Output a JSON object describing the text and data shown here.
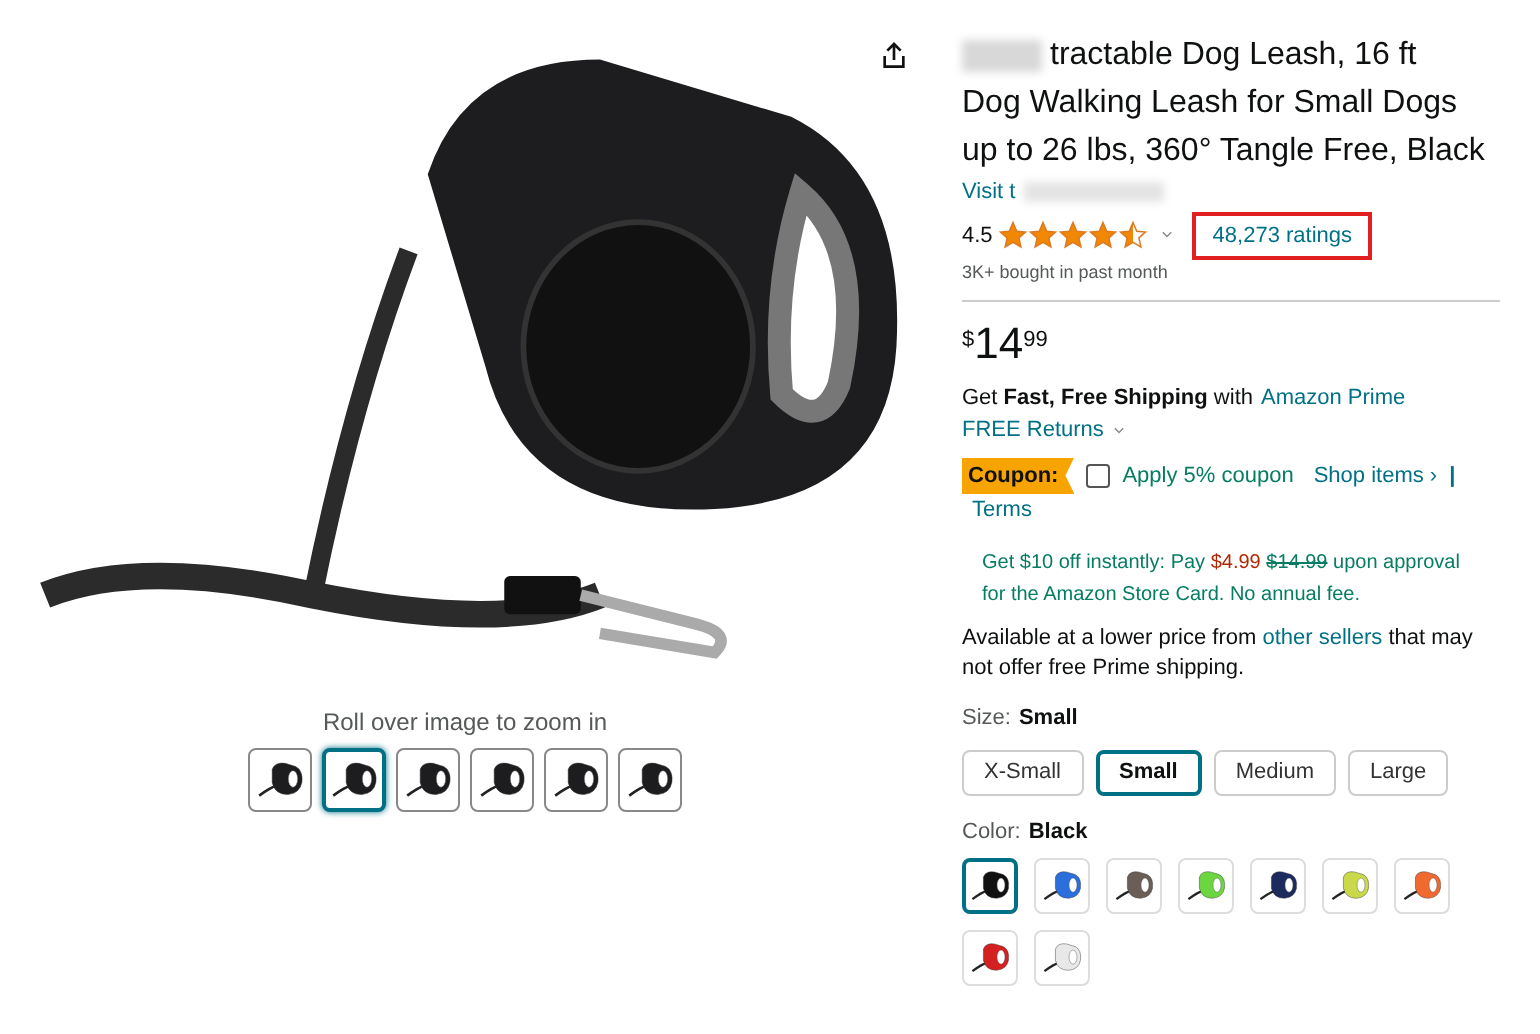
{
  "gallery": {
    "hint": "Roll over image to zoom in",
    "thumbnails": [
      {
        "selected": false
      },
      {
        "selected": true
      },
      {
        "selected": false
      },
      {
        "selected": false
      },
      {
        "selected": false
      },
      {
        "selected": false
      }
    ]
  },
  "product": {
    "title_first_line": "tractable Dog Leash, 16 ft",
    "title_rest": "Dog Walking Leash for Small Dogs up to 26 lbs, 360° Tangle Free, Black",
    "store_link": "Visit t",
    "rating": "4.5",
    "stars": 4.5,
    "ratings_count": "48,273 ratings",
    "bought": "3K+ bought in past month",
    "price": {
      "currency": "$",
      "whole": "14",
      "fraction": "99"
    },
    "shipping": "Get **Fast, Free Shipping** with",
    "prime": "Amazon Prime",
    "returns": "FREE Returns",
    "coupon": {
      "badge": "Coupon:",
      "checked": false,
      "label": "Apply 5% coupon",
      "shop": "Shop items ›",
      "sep": "|",
      "terms": "Terms"
    },
    "card_offer": {
      "text1": "Get $10 off instantly: Pay",
      "new_price": "$4.99",
      "old_price": "$14.99",
      "text2": "upon approval for the Amazon Store Card. No annual fee."
    },
    "lower_price": {
      "before": "Available at a lower price from",
      "link": "other sellers",
      "after": "that may not offer free Prime shipping."
    },
    "size": {
      "label": "Size:",
      "value": "Small",
      "options": [
        {
          "label": "X-Small",
          "selected": false
        },
        {
          "label": "Small",
          "selected": true
        },
        {
          "label": "Medium",
          "selected": false
        },
        {
          "label": "Large",
          "selected": false
        }
      ]
    },
    "color": {
      "label": "Color:",
      "value": "Black",
      "options": [
        {
          "color": "#111111",
          "selected": true
        },
        {
          "color": "#2a6fdb",
          "selected": false
        },
        {
          "color": "#6b5e57",
          "selected": false
        },
        {
          "color": "#6cd640",
          "selected": false
        },
        {
          "color": "#1c2a5e",
          "selected": false
        },
        {
          "color": "#c9d94a",
          "selected": false
        },
        {
          "color": "#f06a30",
          "selected": false
        },
        {
          "color": "#d42020",
          "selected": false
        },
        {
          "color": "#e8e8e8",
          "selected": false
        }
      ]
    }
  }
}
